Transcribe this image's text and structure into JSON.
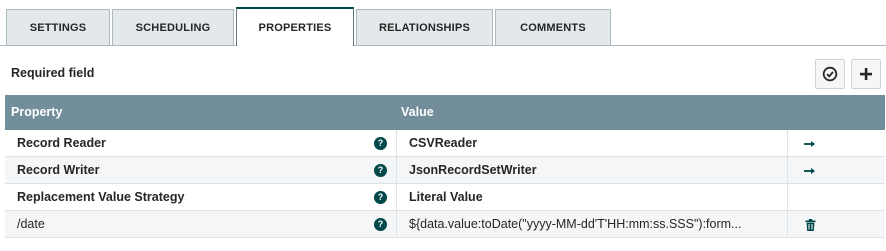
{
  "tabs": [
    {
      "label": "SETTINGS",
      "active": false
    },
    {
      "label": "SCHEDULING",
      "active": false
    },
    {
      "label": "PROPERTIES",
      "active": true
    },
    {
      "label": "RELATIONSHIPS",
      "active": false
    },
    {
      "label": "COMMENTS",
      "active": false
    }
  ],
  "required_field_label": "Required field",
  "toolbar": {
    "verify_icon": "check-circle-icon",
    "add_icon": "plus-icon"
  },
  "table": {
    "columns": [
      "Property",
      "Value"
    ],
    "rows": [
      {
        "property": "Record Reader",
        "value": "CSVReader",
        "required": true,
        "action_icon": "arrow-right-icon"
      },
      {
        "property": "Record Writer",
        "value": "JsonRecordSetWriter",
        "required": true,
        "action_icon": "arrow-right-icon"
      },
      {
        "property": "Replacement Value Strategy",
        "value": "Literal Value",
        "required": true,
        "action_icon": ""
      },
      {
        "property": "/date",
        "value": "${data.value:toDate(\"yyyy-MM-dd'T'HH:mm:ss.SSS\"):form...",
        "required": false,
        "action_icon": "trash-icon"
      }
    ],
    "help_glyph": "?"
  },
  "colors": {
    "header_bg": "#728e9b",
    "accent": "#004849",
    "tab_bg": "#e3e8eb"
  }
}
